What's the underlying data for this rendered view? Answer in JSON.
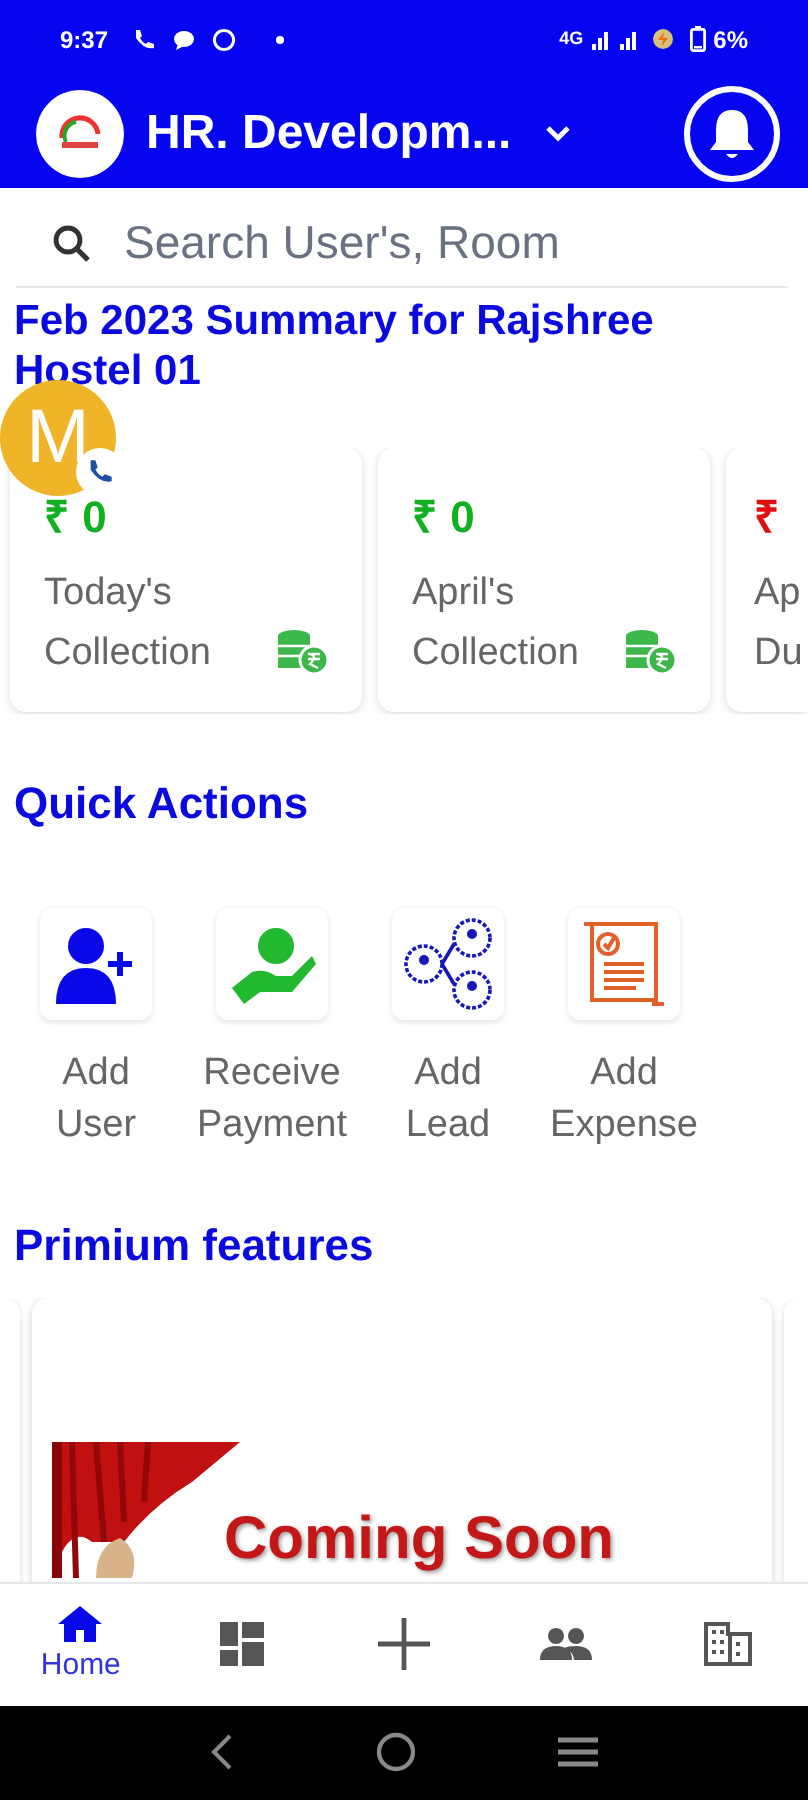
{
  "status_bar": {
    "time": "9:37",
    "network": "4G",
    "battery": "6%"
  },
  "header": {
    "title": "HR. Developm..."
  },
  "search": {
    "placeholder": "Search User's, Room"
  },
  "summary_title": "Feb 2023 Summary for Rajshree Hostel 01",
  "chat_head": {
    "letter": "M"
  },
  "cards": [
    {
      "amount": "₹ 0",
      "label": "Today's Collection",
      "kind": "collection"
    },
    {
      "amount": "₹ 0",
      "label": "April's Collection",
      "kind": "collection"
    },
    {
      "amount": "₹",
      "label": "Ap Du",
      "kind": "due"
    }
  ],
  "quick_actions": {
    "title": "Quick Actions",
    "items": [
      {
        "label": "Add User",
        "kind": "user"
      },
      {
        "label": "Receive Payment",
        "kind": "payment"
      },
      {
        "label": "Add Lead",
        "kind": "lead"
      },
      {
        "label": "Add Expense",
        "kind": "expense"
      }
    ]
  },
  "premium": {
    "title": "Primium features",
    "banner_text": "Coming Soon"
  },
  "bottom_nav": [
    {
      "label": "Home",
      "kind": "home",
      "selected": true
    },
    {
      "kind": "dashboard",
      "selected": false
    },
    {
      "kind": "add",
      "selected": false
    },
    {
      "kind": "people",
      "selected": false
    },
    {
      "kind": "building",
      "selected": false
    }
  ]
}
